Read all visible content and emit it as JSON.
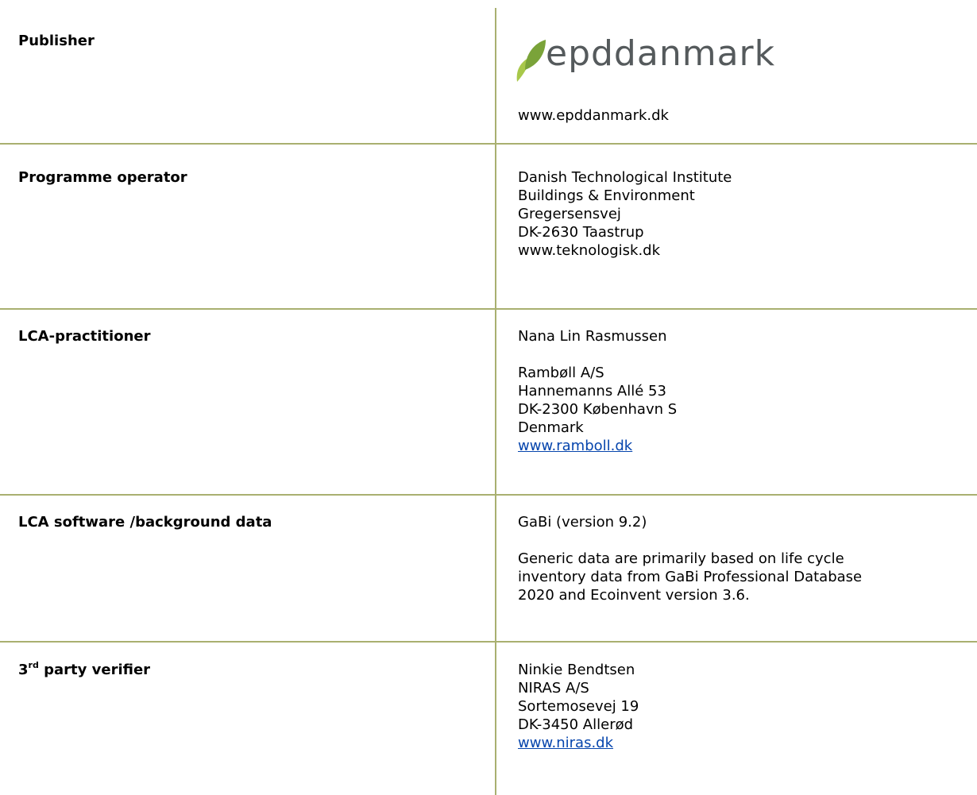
{
  "publisher": {
    "label": "Publisher",
    "logo_text": "epddanmark",
    "logo_colors": {
      "leaf_light": "#a8c84a",
      "leaf_dark": "#7aa339",
      "text": "#555a5c"
    },
    "website": "www.epddanmark.dk"
  },
  "programme_operator": {
    "label": "Programme operator",
    "lines": [
      "Danish Technological Institute",
      "Buildings & Environment",
      "Gregersensvej",
      "DK-2630 Taastrup",
      "www.teknologisk.dk"
    ]
  },
  "lca_practitioner": {
    "label": "LCA-practitioner",
    "name": "Nana Lin Rasmussen",
    "lines": [
      "Rambøll A/S",
      "Hannemanns Allé 53",
      "DK-2300 København S",
      "Denmark"
    ],
    "link": "www.ramboll.dk"
  },
  "lca_software": {
    "label": "LCA software /background data",
    "software": "GaBi (version 9.2)",
    "lines": [
      "Generic data are primarily based on life cycle",
      "inventory data from GaBi Professional Database",
      "2020 and Ecoinvent version 3.6."
    ]
  },
  "verifier": {
    "label_prefix": "3",
    "label_sup": "rd",
    "label_rest": " party verifier",
    "lines": [
      "Ninkie Bendtsen",
      "NIRAS A/S",
      "Sortemosevej 19",
      "DK-3450 Allerød"
    ],
    "link": "www.niras.dk"
  },
  "colors": {
    "rule": "#a9b070",
    "link": "#0645ad"
  }
}
